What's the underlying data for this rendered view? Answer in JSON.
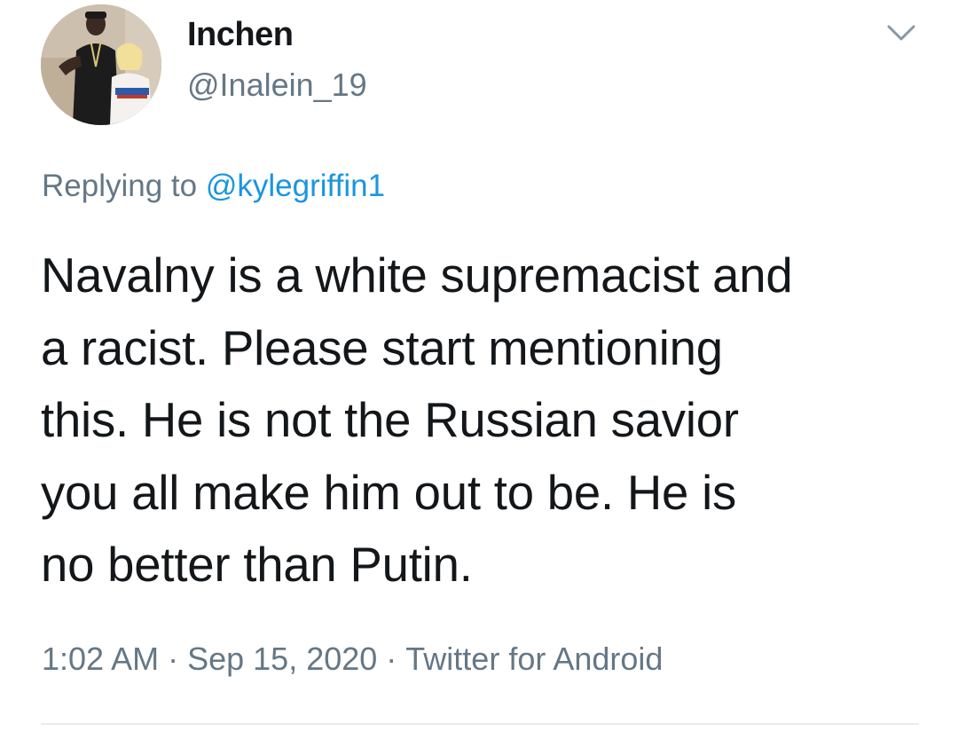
{
  "tweet": {
    "display_name": "Inchen",
    "handle": "@Inalein_19",
    "replying_prefix": "Replying to",
    "replying_to": "@kylegriffin1",
    "text_lines": [
      "Navalny is a white supremacist and",
      "a racist. Please start mentioning",
      "this. He is not the Russian savior",
      "you all make him out to be. He is",
      "no better than Putin."
    ],
    "time": "1:02 AM",
    "separator": "·",
    "date": "Sep 15, 2020",
    "source": "Twitter for Android"
  },
  "icons": {
    "menu": "chevron-down-icon",
    "avatar": "profile-photo"
  },
  "colors": {
    "text_primary": "#14171a",
    "text_secondary": "#657786",
    "link": "#1b95e0",
    "divider": "#e6ecf0"
  }
}
